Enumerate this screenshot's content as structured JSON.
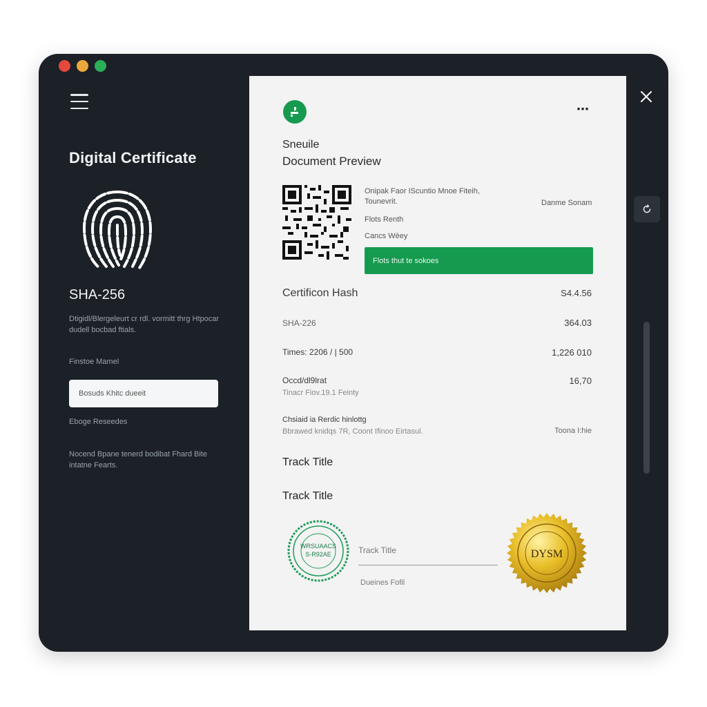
{
  "sidebar": {
    "title": "Digital Certificate",
    "hash_label": "SHA-256",
    "description": "Dtigidl/Blergeleurt cr rdl. vormitt thrg Htpocar dudell bocbad ftials.",
    "field_label": "Finstoe Mamel",
    "input_value": "Bosuds Khitc dueeit",
    "label2": "Eboge Reseedes",
    "description2": "Nocend Bpane tenerd bodibat Fhard Bite intatne Fearts."
  },
  "document": {
    "subtitle": "Sneuile",
    "title": "Document Preview",
    "more_icon": "⋯",
    "meta_line1": "Onipak Faor IScuntio Mnoe Fiteih, Tounevrit.",
    "meta_right": "Danme Sonam",
    "meta_line2": "Flots Renth",
    "meta_line3": "Cancs Wèey",
    "verify_button": "Flots thut te sokoes",
    "rows": [
      {
        "label": "Certificon Hash",
        "value": "S4.4.56"
      },
      {
        "label": "SHA-226",
        "value": "364.03"
      },
      {
        "label": "Times: 2206 / | 500",
        "value": "1,226 010"
      },
      {
        "label": "Occd/dl9lrat",
        "sub": "Tinacr Fiov.19.1 Feinty",
        "value": "16,70"
      },
      {
        "label": "Chsiaid ia Rerdic hinlottg",
        "sub": "Bbrawed knidqs 7R, Coont Ifinoo Eirtasul.",
        "value": "Toona I:hie"
      }
    ],
    "track_title_1": "Track Title",
    "track_title_2": "Track Title",
    "signature_label": "Track Title",
    "signature_name": "Dueines Fofil",
    "stamp_text_1": "WRSUAACS",
    "stamp_text_2": "S-R92AE",
    "seal_text": "DYSM"
  },
  "colors": {
    "brand_green": "#169a4f",
    "seal_gold": "#e0b21f",
    "window_bg": "#1c2127"
  },
  "icons": {
    "menu": "hamburger-icon",
    "close": "close-icon",
    "refresh": "refresh-icon",
    "fingerprint": "fingerprint-icon",
    "logo": "document-logo-icon"
  }
}
